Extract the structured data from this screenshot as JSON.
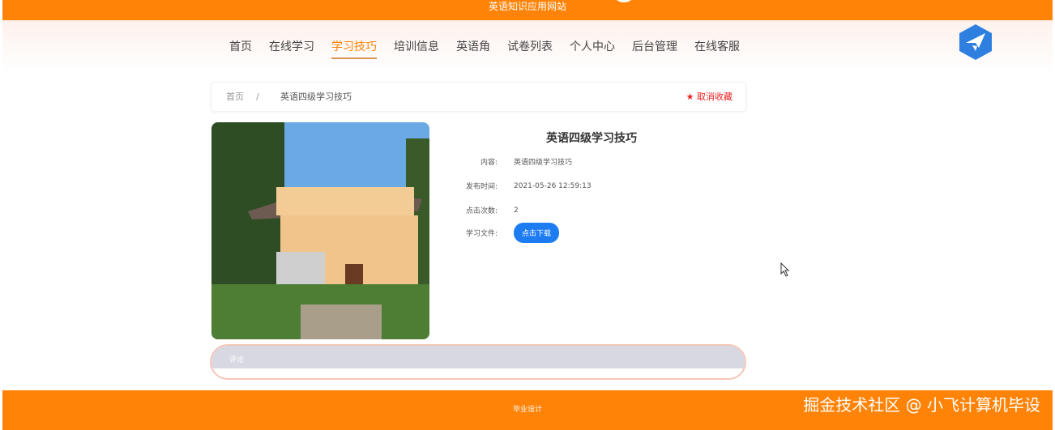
{
  "site": {
    "title": "英语知识应用网站"
  },
  "nav": {
    "items": [
      "首页",
      "在线学习",
      "学习技巧",
      "培训信息",
      "英语角",
      "试卷列表",
      "个人中心",
      "后台管理",
      "在线客服"
    ],
    "active": 2
  },
  "breadcrumb": {
    "home": "首页",
    "sep": "/",
    "current": "英语四级学习技巧",
    "favorite": "★ 取消收藏"
  },
  "detail": {
    "title": "英语四级学习技巧",
    "fields": [
      {
        "label": "内容:",
        "value": "英语四级学习技巧"
      },
      {
        "label": "发布时间:",
        "value": "2021-05-26 12:59:13"
      },
      {
        "label": "点击次数:",
        "value": "2"
      }
    ],
    "file_label": "学习文件:",
    "download": "点击下载"
  },
  "comment": {
    "label": "评论"
  },
  "footer": {
    "text": "毕业设计"
  },
  "watermark": "掘金技术社区 @ 小飞计算机毕设",
  "colors": {
    "brand": "#ff8307",
    "button": "#1e7cf2",
    "favorite": "#e22222"
  }
}
